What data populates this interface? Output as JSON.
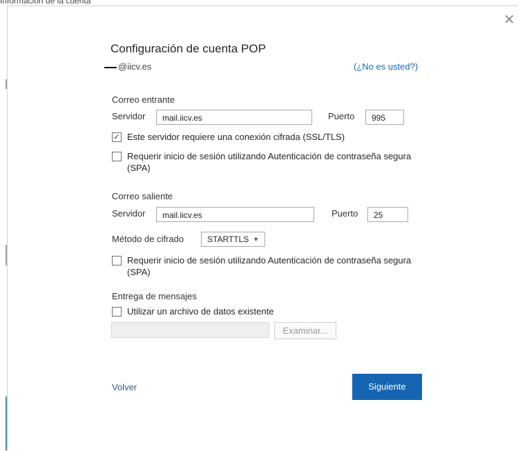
{
  "background": {
    "title_fragment": "Información de la cuenta"
  },
  "dialog": {
    "close_icon": "close-icon",
    "title": "Configuración de cuenta POP",
    "account_email": "@iicv.es",
    "not_you_link": "(¿No es usted?)"
  },
  "incoming": {
    "heading": "Correo entrante",
    "server_label": "Servidor",
    "server_value": "mail.iicv.es",
    "port_label": "Puerto",
    "port_value": "995",
    "ssl_checked": true,
    "ssl_label": "Este servidor requiere una conexión cifrada (SSL/TLS)",
    "spa_checked": false,
    "spa_label": "Requerir inicio de sesión utilizando Autenticación de contraseña segura (SPA)"
  },
  "outgoing": {
    "heading": "Correo saliente",
    "server_label": "Servidor",
    "server_value": "mail.iicv.es",
    "port_label": "Puerto",
    "port_value": "25",
    "encryption_label": "Método de cifrado",
    "encryption_value": "STARTTLS",
    "spa_checked": false,
    "spa_label": "Requerir inicio de sesión utilizando Autenticación de contraseña segura (SPA)"
  },
  "delivery": {
    "heading": "Entrega de mensajes",
    "existing_file_checked": false,
    "existing_file_label": "Utilizar un archivo de datos existente",
    "browse_label": "Examinar..."
  },
  "footer": {
    "back_label": "Volver",
    "next_label": "Siguiente"
  },
  "colors": {
    "accent": "#1565b3",
    "link": "#0f6cbd"
  }
}
